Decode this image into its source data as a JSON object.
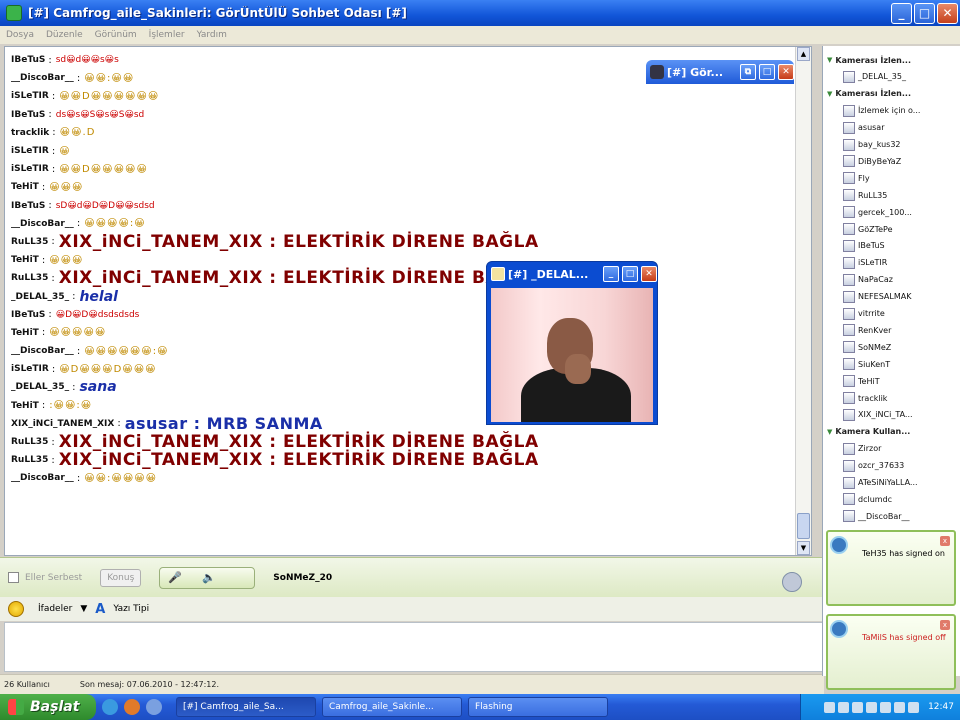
{
  "window": {
    "title": "[#] Camfrog_aile_Sakinleri: GörÜntÜlÜ Sohbet Odası [#]"
  },
  "menu": [
    "Dosya",
    "Düzenle",
    "Görünüm",
    "İşlemler",
    "Yardım"
  ],
  "chat": [
    {
      "nick": "IBeTuS",
      "text": "sd😀d😀😀s😀s",
      "style": "red"
    },
    {
      "nick": "__DiscoBar__",
      "text": "😀😀:😀😀",
      "style": "smiles"
    },
    {
      "nick": "iSLeTIR",
      "text": "😀😀D😀😀😀😀😀😀",
      "style": "smiles"
    },
    {
      "nick": "IBeTuS",
      "text": "ds😀s😀S😀s😀S😀sd",
      "style": "red"
    },
    {
      "nick": "tracklik",
      "text": "😀😀.D",
      "style": "smiles"
    },
    {
      "nick": "iSLeTIR",
      "text": "😀",
      "style": "smiles"
    },
    {
      "nick": "iSLeTIR",
      "text": "😀😀D😀😀😀😀😀",
      "style": "smiles"
    },
    {
      "nick": "TeHiT",
      "text": "😀😀😀",
      "style": "smiles"
    },
    {
      "nick": "IBeTuS",
      "text": "sD😀d😀D😀D😀😀sdsd",
      "style": "red"
    },
    {
      "nick": "__DiscoBar__",
      "text": "😀😀😀😀:😀",
      "style": "smiles"
    },
    {
      "nick": "RuLL35",
      "text": "XIX_iNCi_TANEM_XIX : ELEKTİRİK DİRENE BAĞLA",
      "style": "big"
    },
    {
      "nick": "TeHiT",
      "text": "😀😀😀",
      "style": "smiles"
    },
    {
      "nick": "RuLL35",
      "text": "XIX_iNCi_TANEM_XIX : ELEKTİRİK DİRENE BAĞLA",
      "style": "big"
    },
    {
      "nick": "_DELAL_35_",
      "text": "helal",
      "style": "blue"
    },
    {
      "nick": "IBeTuS",
      "text": "😀D😀D😀dsdsdsds",
      "style": "red"
    },
    {
      "nick": "TeHiT",
      "text": "😀😀😀😀😀",
      "style": "smiles"
    },
    {
      "nick": "__DiscoBar__",
      "text": "😀😀😀😀😀😀:😀",
      "style": "smiles"
    },
    {
      "nick": "iSLeTIR",
      "text": "😀D😀😀😀D😀😀😀",
      "style": "smiles"
    },
    {
      "nick": "_DELAL_35_",
      "text": "sana",
      "style": "blue"
    },
    {
      "nick": "TeHiT",
      "text": ":😀😀:😀",
      "style": "smiles"
    },
    {
      "nick": "XIX_iNCi_TANEM_XIX",
      "text": "asusar : MRB SANMA",
      "style": "navy"
    },
    {
      "nick": "RuLL35",
      "text": "XIX_iNCi_TANEM_XIX : ELEKTİRİK DİRENE BAĞLA",
      "style": "big"
    },
    {
      "nick": "RuLL35",
      "text": "XIX_iNCi_TANEM_XIX : ELEKTİRİK DİRENE BAĞLA",
      "style": "big"
    },
    {
      "nick": "__DiscoBar__",
      "text": "😀😀:😀😀😀😀",
      "style": "smiles"
    }
  ],
  "miniwin": {
    "title": "[#] Gör..."
  },
  "camwin": {
    "title": "[#] _DELAL..."
  },
  "bottombar": {
    "free_talk": "Eller Serbest",
    "talk_button": "Konuş",
    "current_user": "SoNMeZ_20"
  },
  "toolbar2": {
    "emotes": "İfadeler",
    "font": "Yazı Tipi"
  },
  "status": {
    "users": "26 Kullanıcı",
    "last_message": "Son mesaj: 07.06.2010 - 12:47:12."
  },
  "sidebar": {
    "items": [
      {
        "label": "Kamerası İzlen...",
        "type": "grp"
      },
      {
        "label": "_DELAL_35_",
        "type": "user"
      },
      {
        "label": "Kamerası İzlen...",
        "type": "grp"
      },
      {
        "label": "İzlemek için o...",
        "type": "user"
      },
      {
        "label": "asusar",
        "type": "user"
      },
      {
        "label": "bay_kus32",
        "type": "user"
      },
      {
        "label": "DiByBeYaZ",
        "type": "user"
      },
      {
        "label": "Fly",
        "type": "user"
      },
      {
        "label": "RuLL35",
        "type": "user"
      },
      {
        "label": "gercek_100...",
        "type": "user"
      },
      {
        "label": "GöZTePe",
        "type": "user"
      },
      {
        "label": "IBeTuS",
        "type": "user"
      },
      {
        "label": "iSLeTIR",
        "type": "user"
      },
      {
        "label": "NaPaCaz",
        "type": "user"
      },
      {
        "label": "NEFESALMAK",
        "type": "user"
      },
      {
        "label": "vitrrite",
        "type": "user"
      },
      {
        "label": "RenKver",
        "type": "user"
      },
      {
        "label": "SoNMeZ",
        "type": "user"
      },
      {
        "label": "SiuKenT",
        "type": "user"
      },
      {
        "label": "TeHiT",
        "type": "user"
      },
      {
        "label": "tracklik",
        "type": "user"
      },
      {
        "label": "XIX_iNCi_TA...",
        "type": "user"
      },
      {
        "label": "Kamera Kullan...",
        "type": "grp"
      },
      {
        "label": "Zirzor",
        "type": "user"
      },
      {
        "label": "ozcr_37633",
        "type": "user"
      },
      {
        "label": "ATeSiNiYaLLA...",
        "type": "user"
      },
      {
        "label": "dclumdc",
        "type": "user"
      },
      {
        "label": "__DiscoBar__",
        "type": "user"
      }
    ]
  },
  "notifications": [
    {
      "text": "TeH35 has signed on"
    },
    {
      "text": "TaMilS has signed off"
    }
  ],
  "taskbar": {
    "start": "Başlat",
    "buttons": [
      "[#] Camfrog_aile_Sa...",
      "Camfrog_aile_Sakinle...",
      "Flashing"
    ],
    "clock": "12:47"
  }
}
